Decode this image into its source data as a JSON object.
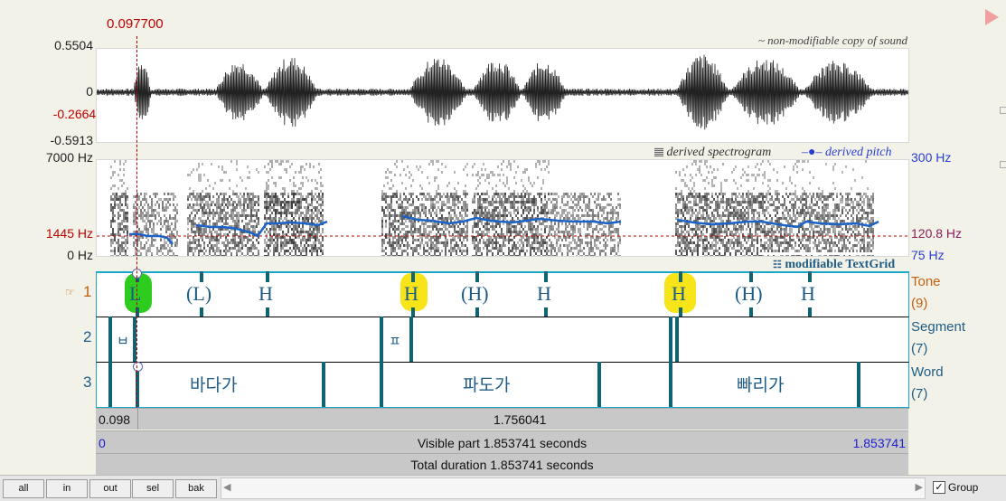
{
  "cursor": {
    "time_label": "0.097700"
  },
  "waveform": {
    "y_max": "0.5504",
    "y_zero": "0",
    "y_cursor": "-0.2664",
    "y_min": "-0.5913",
    "caption": "~ non-modifiable copy of sound"
  },
  "spectrogram": {
    "freq_max": "7000 Hz",
    "freq_cursor": "1445 Hz",
    "freq_min": "0 Hz",
    "legend_spec": "derived spectrogram",
    "legend_pitch": "derived pitch",
    "pitch_max": "300 Hz",
    "pitch_cursor": "120.8 Hz",
    "pitch_min": "75 Hz",
    "colors": {
      "pitch": "#1c63c8",
      "cursor": "#c00000"
    }
  },
  "textgrid": {
    "caption": "modifiable TextGrid",
    "tiers": [
      {
        "number": "1",
        "name": "Tone",
        "count": "(9)"
      },
      {
        "number": "2",
        "name": "Segment",
        "count": "(7)"
      },
      {
        "number": "3",
        "name": "Word",
        "count": "(7)"
      }
    ],
    "tone_labels": [
      "L",
      "(L)",
      "H",
      "H",
      "(H)",
      "H",
      "H",
      "(H)",
      "H"
    ],
    "segment_labels": [
      "ㅂ",
      "ㅍ"
    ],
    "word_labels": [
      "바다가",
      "파도가",
      "빠리가"
    ]
  },
  "info": {
    "left_time": "0.098",
    "selection_duration": "1.756041",
    "visible_start": "0",
    "visible_text": "Visible part 1.853741 seconds",
    "visible_end": "1.853741",
    "total_text": "Total duration 1.853741 seconds"
  },
  "buttons": {
    "all": "all",
    "in": "in",
    "out": "out",
    "sel": "sel",
    "bak": "bak"
  },
  "group": {
    "label": "Group",
    "checked": true
  }
}
